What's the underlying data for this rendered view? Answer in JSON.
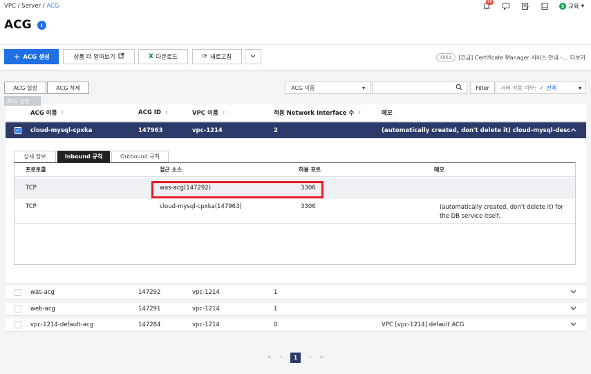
{
  "breadcrumb": {
    "part1": "VPC",
    "sep": "/",
    "part2": "Server",
    "current": "ACG"
  },
  "title": "ACG",
  "title_badge": "ℹ",
  "header": {
    "notif_badge": "88",
    "user_initial": "S",
    "user_label": "교육"
  },
  "toolbar": {
    "create": "ACG 생성",
    "create_plus": "+",
    "learn_more": "상품 더 알아보기",
    "download": "다운로드",
    "download_x": "X",
    "refresh": "새로고침",
    "service_tag": "서비스",
    "notice": "[긴급] Certificate Manager 서비스 안내 -...",
    "more": "더보기"
  },
  "filter": {
    "acg_setting": "ACG 설정",
    "acg_delete": "ACG 삭제",
    "ghost_label": "ACG 설정",
    "select_value": "ACG 이름",
    "filter_label": "Filter",
    "apply_key": "서버 적용 여부:",
    "apply_check": "✓",
    "apply_value": "전체"
  },
  "table": {
    "headers": {
      "name": "ACG 이름",
      "id": "ACG ID",
      "vpc": "VPC 이름",
      "nic": "적용 Network Interface 수",
      "memo": "메모"
    },
    "selected_row": {
      "name": "cloud-mysql-cpxka",
      "id": "147963",
      "vpc": "vpc-1214",
      "nic": "2",
      "memo": "(automatically created, don't delete it) cloud-mysql-desc"
    },
    "rows": [
      {
        "name": "was-acg",
        "id": "147292",
        "vpc": "vpc-1214",
        "nic": "1",
        "memo": ""
      },
      {
        "name": "web-acg",
        "id": "147291",
        "vpc": "vpc-1214",
        "nic": "1",
        "memo": ""
      },
      {
        "name": "vpc-1214-default-acg",
        "id": "147284",
        "vpc": "vpc-1214",
        "nic": "0",
        "memo": "VPC [vpc-1214] default ACG"
      }
    ]
  },
  "detail": {
    "tabs": [
      "상세 정보",
      "Inbound 규칙",
      "Outbound 규칙"
    ],
    "inner_headers": {
      "protocol": "프로토콜",
      "source": "접근 소스",
      "port": "허용 포트",
      "memo": "메모"
    },
    "rules": [
      {
        "protocol": "TCP",
        "source": "was-acg(147292)",
        "port": "3306",
        "memo": ""
      },
      {
        "protocol": "TCP",
        "source": "cloud-mysql-cpxka(147963)",
        "port": "3306",
        "memo": "(automatically created, don't delete it) for the DB service itself."
      }
    ]
  },
  "pager": {
    "first": "«",
    "prev": "‹",
    "current": "1",
    "next": "›",
    "last": "»"
  },
  "colors": {
    "primary": "#1f6fe5",
    "selected_row": "#2b3a68",
    "highlight": "#e31b23",
    "excel_green": "#107c41"
  }
}
